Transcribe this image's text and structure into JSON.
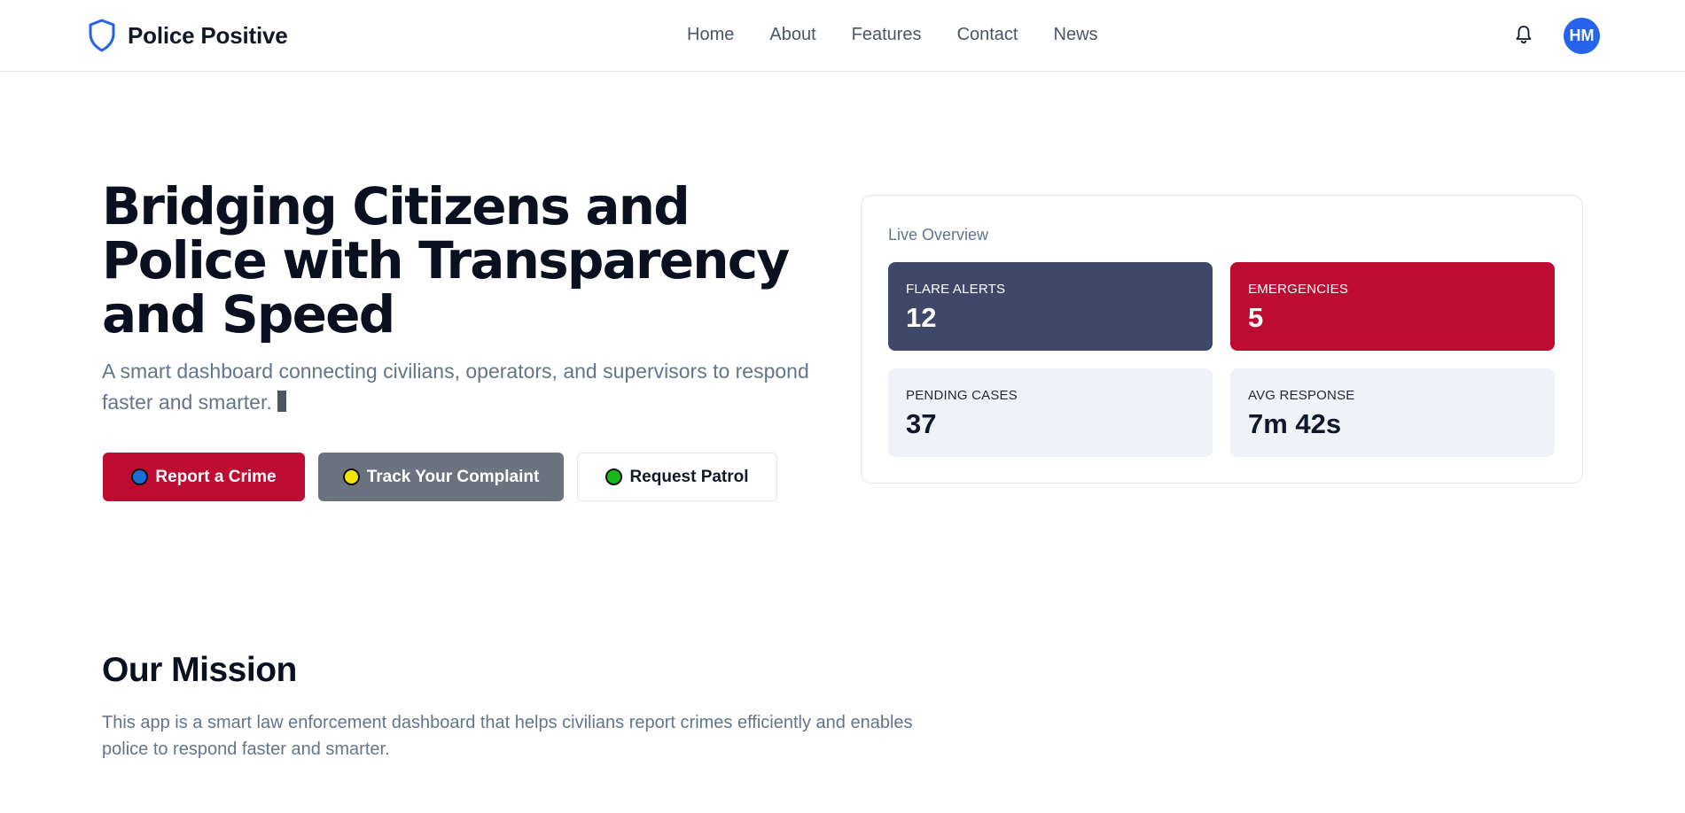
{
  "header": {
    "brand": "Police Positive",
    "nav": [
      "Home",
      "About",
      "Features",
      "Contact",
      "News"
    ],
    "avatar_initials": "HM"
  },
  "hero": {
    "title": "Bridging Citizens and Police with Transparency and Speed",
    "subtitle": "A smart dashboard connecting civilians, operators, and supervisors to respond faster and smarter.",
    "buttons": {
      "report": "Report a Crime",
      "track": "Track Your Complaint",
      "patrol": "Request Patrol"
    }
  },
  "overview": {
    "title": "Live Overview",
    "stats": [
      {
        "label": "FLARE ALERTS",
        "value": "12"
      },
      {
        "label": "EMERGENCIES",
        "value": "5"
      },
      {
        "label": "PENDING CASES",
        "value": "37"
      },
      {
        "label": "AVG RESPONSE",
        "value": "7m 42s"
      }
    ]
  },
  "mission": {
    "title": "Our Mission",
    "text": "This app is a smart law enforcement dashboard that helps civilians report crimes efficiently and enables police to respond faster and smarter."
  },
  "colors": {
    "accent_red": "#be0b32",
    "slate_card": "#3f4868",
    "gray_button": "#6b7280",
    "avatar_blue": "#2563eb",
    "dot_report": "#1d6fd8",
    "dot_track": "#f5e500",
    "dot_patrol": "#18b81a"
  },
  "icons": {
    "brand": "shield-icon",
    "notifications": "bell-icon"
  }
}
